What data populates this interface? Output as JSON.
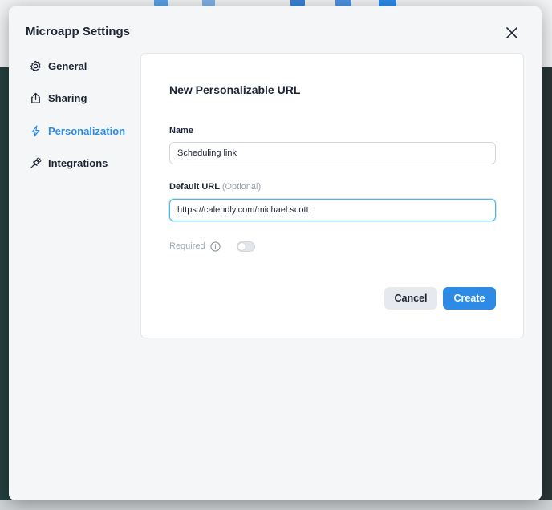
{
  "modal": {
    "title": "Microapp Settings"
  },
  "nav": {
    "items": [
      {
        "label": "General",
        "icon": "gear-icon"
      },
      {
        "label": "Sharing",
        "icon": "share-icon"
      },
      {
        "label": "Personalization",
        "icon": "lightning-icon",
        "active": true
      },
      {
        "label": "Integrations",
        "icon": "plug-icon"
      }
    ]
  },
  "form": {
    "title": "New Personalizable URL",
    "name_label": "Name",
    "name_value": "Scheduling link",
    "url_label": "Default URL",
    "url_optional": "(Optional)",
    "url_value": "https://calendly.com/michael.scott",
    "required_label": "Required",
    "required_on": false,
    "cancel_label": "Cancel",
    "create_label": "Create"
  },
  "colors": {
    "accent": "#2d8be6",
    "text": "#1d2433",
    "muted": "#9aa2ad"
  }
}
